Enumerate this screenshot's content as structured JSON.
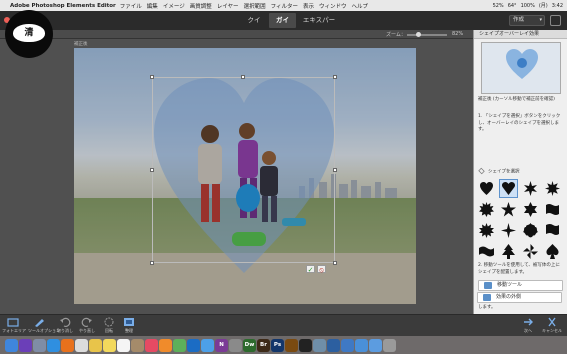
{
  "menubar": {
    "app_name": "Adobe Photoshop Elements Editor",
    "items": [
      "ファイル",
      "編集",
      "イメージ",
      "画質調整",
      "レイヤー",
      "選択範囲",
      "フィルター",
      "表示",
      "ウィンドウ",
      "ヘルプ"
    ],
    "status": [
      "52%",
      "64°",
      "100%",
      "(月)",
      "3:42"
    ]
  },
  "modes": {
    "quick": "クイック",
    "guided": "ガイド",
    "expert": "エキスパート",
    "create": "作成"
  },
  "options": {
    "zoom_label": "ズーム：",
    "zoom_value": "82%"
  },
  "document": {
    "tab_label": "補正後"
  },
  "panel": {
    "title": "シェイプオーバーレイ効果",
    "section_heading": "補正後 (カーソル移動で補正前を確認)",
    "step1": "1. 「シェイプを選択」ボタンをクリックし、オーバーレイのシェイプを選択します。",
    "select_shape_label": "シェイプを選択",
    "step2": "2. 移動ツールを使用して、被写体の上にシェイプを配置します。",
    "move_tool_label": "移動ツール",
    "step3": "3. シェイプの外側に適用する効果を選択します。",
    "effect_label": "効果の外側"
  },
  "shapes": [
    "heart-round",
    "heart",
    "starburst-8",
    "star-many",
    "burst",
    "star-5",
    "star-6",
    "wavy-banner",
    "starburst-12",
    "cross",
    "flower",
    "flag",
    "banner-wave",
    "tree",
    "pinwheel",
    "spade"
  ],
  "bottombar": {
    "photo_bin": "フォトエリア",
    "tool_options": "ツールオプション",
    "undo": "取り消し",
    "redo": "やり直し",
    "rotate": "回転",
    "organizer": "整理",
    "next": "次へ",
    "cancel": "キャンセル"
  },
  "dock": [
    {
      "name": "finder",
      "label": "",
      "color": "#3f86dd"
    },
    {
      "name": "siri",
      "label": "",
      "color": "#6b3fb8"
    },
    {
      "name": "launchpad",
      "label": "",
      "color": "#7f8da6"
    },
    {
      "name": "safari",
      "label": "",
      "color": "#2f8fe0"
    },
    {
      "name": "firefox",
      "label": "",
      "color": "#e8711c"
    },
    {
      "name": "chrome",
      "label": "",
      "color": "#dcdcdc"
    },
    {
      "name": "photos",
      "label": "",
      "color": "#e8c44a"
    },
    {
      "name": "notes",
      "label": "",
      "color": "#f3d95c"
    },
    {
      "name": "calendar",
      "label": "",
      "color": "#f5f5f5"
    },
    {
      "name": "contacts",
      "label": "",
      "color": "#a58b6a"
    },
    {
      "name": "music",
      "label": "",
      "color": "#e64a63"
    },
    {
      "name": "books",
      "label": "",
      "color": "#f08b2b"
    },
    {
      "name": "maps",
      "label": "",
      "color": "#5db05a"
    },
    {
      "name": "outlook",
      "label": "",
      "color": "#1b6cc4"
    },
    {
      "name": "mail",
      "label": "",
      "color": "#4da0e8"
    },
    {
      "name": "onenote",
      "label": "N",
      "color": "#7b3a96"
    },
    {
      "name": "settings",
      "label": "",
      "color": "#8a8a8a"
    },
    {
      "name": "dreamweaver",
      "label": "Dw",
      "color": "#2d6a2d"
    },
    {
      "name": "bridge",
      "label": "Br",
      "color": "#3d2a18"
    },
    {
      "name": "photoshop",
      "label": "Ps",
      "color": "#13366a"
    },
    {
      "name": "illustrator",
      "label": "",
      "color": "#7a4a10"
    },
    {
      "name": "terminal",
      "label": "",
      "color": "#222"
    },
    {
      "name": "preview",
      "label": "",
      "color": "#6f8ea8"
    },
    {
      "name": "elements",
      "label": "",
      "color": "#2c5fa0"
    },
    {
      "name": "elements-2",
      "label": "",
      "color": "#3f79c4"
    },
    {
      "name": "folder",
      "label": "",
      "color": "#4a90d9"
    },
    {
      "name": "downloads",
      "label": "",
      "color": "#5c9ce0"
    },
    {
      "name": "trash",
      "label": "",
      "color": "#9a9a9a"
    }
  ],
  "watermark": {
    "text": "清"
  }
}
